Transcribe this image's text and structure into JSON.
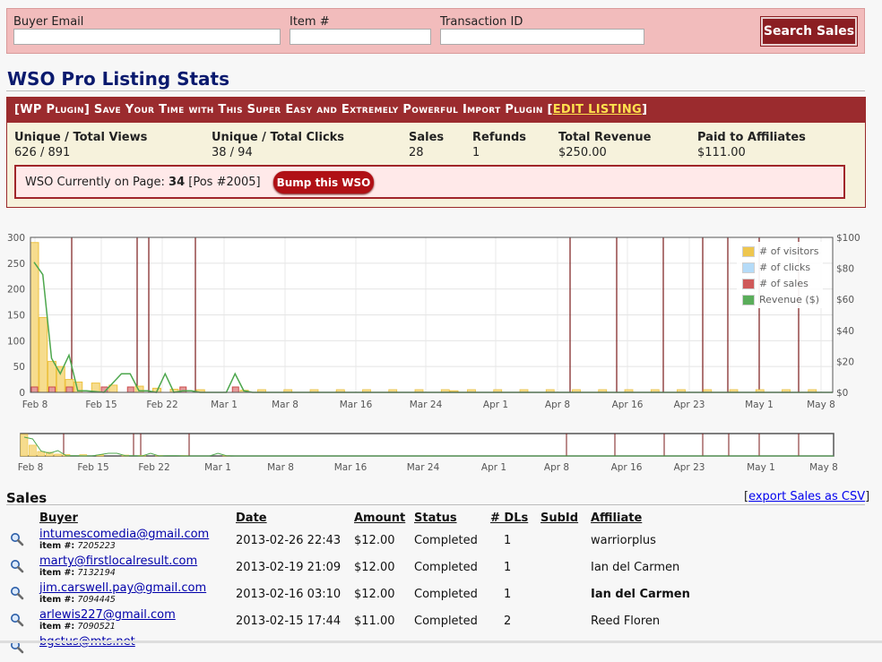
{
  "search": {
    "buyer_email_label": "Buyer Email",
    "buyer_email_value": "",
    "item_label": "Item #",
    "item_value": "",
    "transaction_label": "Transaction ID",
    "transaction_value": "",
    "button_label": "Search Sales"
  },
  "page_title": "WSO Pro Listing Stats",
  "listing": {
    "title": "[WP Plugin] Save Your Time with This Super Easy and Extremely Powerful Import Plugin [",
    "edit_link": "EDIT LISTING",
    "title_end": "]",
    "stats": [
      {
        "label": "Unique / Total Views",
        "value": "626 / 891"
      },
      {
        "label": "Unique / Total Clicks",
        "value": "38 / 94"
      },
      {
        "label": "Sales",
        "value": "28"
      },
      {
        "label": "Refunds",
        "value": "1"
      },
      {
        "label": "Total Revenue",
        "value": "$250.00"
      },
      {
        "label": "Paid to Affiliates",
        "value": "$111.00"
      }
    ],
    "page_prefix": "WSO Currently on Page: ",
    "page_number": "34",
    "page_pos": " [Pos #2005]",
    "bump_label": "Bump this WSO"
  },
  "chart_data": {
    "type": "bar",
    "x_ticks": [
      "Feb 8",
      "Feb 15",
      "Feb 22",
      "Mar 1",
      "Mar 8",
      "Mar 16",
      "Mar 24",
      "Apr 1",
      "Apr 8",
      "Apr 16",
      "Apr 23",
      "May 1",
      "May 8"
    ],
    "y_left_ticks": [
      "300",
      "250",
      "200",
      "150",
      "100",
      "50",
      "0"
    ],
    "y_right_ticks": [
      "$100",
      "$80",
      "$60",
      "$40",
      "$20",
      "$0"
    ],
    "ylim_left": [
      0,
      300
    ],
    "ylim_right": [
      0,
      100
    ],
    "legend": [
      "# of visitors",
      "# of clicks",
      "# of sales",
      "Revenue ($)"
    ],
    "legend_colors": [
      "#edc240",
      "#afd8f8",
      "#cb4b4b",
      "#4da74d"
    ],
    "visitor_days": [
      0,
      1,
      2,
      3,
      4,
      5,
      7,
      9,
      12,
      14,
      16,
      19,
      24,
      35,
      48,
      62
    ],
    "visitor_values": [
      290,
      145,
      60,
      50,
      25,
      20,
      18,
      14,
      12,
      8,
      6,
      5,
      4,
      3,
      3,
      2
    ],
    "revenue_days": [
      0,
      1,
      2,
      3,
      4,
      5,
      6,
      8,
      9,
      10,
      11,
      12,
      13,
      14,
      15,
      16,
      17,
      18,
      19,
      21,
      22,
      23,
      24,
      25
    ],
    "revenue_values": [
      84,
      76,
      22,
      12,
      24,
      1,
      1,
      0,
      6,
      12,
      12,
      1,
      1,
      0,
      12,
      0,
      1,
      1,
      0,
      0,
      0,
      12,
      1,
      0
    ],
    "sales_days": [
      0,
      2,
      4,
      8,
      11,
      17,
      23
    ],
    "overview_x_ticks": [
      "Feb 8",
      "Feb 15",
      "Feb 22",
      "Mar 1",
      "Mar 8",
      "Mar 16",
      "Mar 24",
      "Apr 1",
      "Apr 8",
      "Apr 16",
      "Apr 23",
      "May 1",
      "May 8"
    ]
  },
  "sales": {
    "title": "Sales",
    "export_link": "export Sales as CSV",
    "headers": {
      "buyer": "Buyer",
      "date": "Date",
      "amount": "Amount",
      "status": "Status",
      "dls": "# DLs",
      "subid": "SubId",
      "affiliate": "Affiliate"
    },
    "item_prefix": "item #: ",
    "rows": [
      {
        "buyer": "intumescomedia@gmail.com",
        "item": "7205223",
        "date": "2013-02-26 22:43",
        "amount": "$12.00",
        "status": "Completed",
        "dls": "1",
        "subid": "",
        "affiliate": "warriorplus"
      },
      {
        "buyer": "marty@firstlocalresult.com",
        "item": "7132194",
        "date": "2013-02-19 21:09",
        "amount": "$12.00",
        "status": "Completed",
        "dls": "1",
        "subid": "",
        "affiliate": "Ian del Carmen"
      },
      {
        "buyer": "jim.carswell.pay@gmail.com",
        "item": "7094445",
        "date": "2013-02-16 03:10",
        "amount": "$12.00",
        "status": "Completed",
        "dls": "1",
        "subid": "",
        "affiliate": "Ian del Carmen"
      },
      {
        "buyer": "arlewis227@gmail.com",
        "item": "7090521",
        "date": "2013-02-15 17:44",
        "amount": "$11.00",
        "status": "Completed",
        "dls": "2",
        "subid": "",
        "affiliate": "Reed Floren"
      },
      {
        "buyer": "bgctus@mts.net",
        "item": "",
        "date": "",
        "amount": "",
        "status": "",
        "dls": "",
        "subid": "",
        "affiliate": ""
      }
    ]
  }
}
